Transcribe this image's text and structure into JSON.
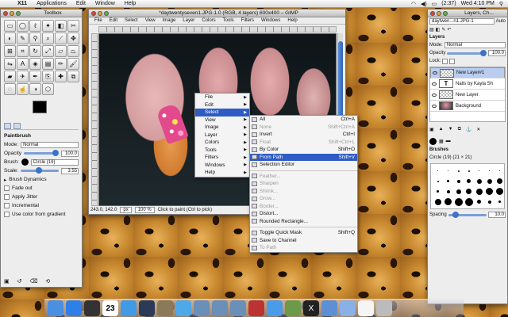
{
  "menubar": {
    "app": "X11",
    "items": [
      "Applications",
      "Edit",
      "Window",
      "Help"
    ],
    "clock": "Wed 4:10 PM",
    "battery": "(2:37)"
  },
  "toolbox": {
    "title": "Toolbox",
    "tool_icons": [
      "rect-select-icon",
      "ellipse-select-icon",
      "free-select-icon",
      "fuzzy-select-icon",
      "color-select-icon",
      "scissors-icon",
      "foreground-select-icon",
      "paths-icon",
      "color-picker-icon",
      "zoom-icon",
      "measure-icon",
      "move-icon",
      "align-icon",
      "crop-icon",
      "rotate-icon",
      "scale-icon",
      "shear-icon",
      "perspective-icon",
      "flip-icon",
      "text-icon",
      "bucket-fill-icon",
      "blend-icon",
      "pencil-icon",
      "paintbrush-icon",
      "eraser-icon",
      "airbrush-icon",
      "ink-icon",
      "clone-icon",
      "heal-icon",
      "perspective-clone-icon",
      "blur-icon",
      "smudge-icon",
      "dodge-burn-icon",
      "cage-icon"
    ],
    "options": {
      "title": "Paintbrush",
      "mode_label": "Mode:",
      "mode_value": "Normal",
      "opacity_label": "Opacity",
      "opacity_value": "100.0",
      "brush_label": "Brush:",
      "brush_value": "Circle (19)",
      "scale_label": "Scale:",
      "scale_value": "3.55",
      "dynamics": "Brush Dynamics",
      "fade_out": "Fade out",
      "apply_jitter": "Apply Jitter",
      "incremental": "Incremental",
      "use_color": "Use color from gradient"
    }
  },
  "image_window": {
    "title": "*daytwentyseven1.JPG-1.0 (RGB, 4 layers) 600x400 – GIMP",
    "menu": [
      "File",
      "Edit",
      "Select",
      "View",
      "Image",
      "Layer",
      "Colors",
      "Tools",
      "Filters",
      "Windows",
      "Help"
    ],
    "coords": "243.0, 142.0",
    "unit": "px",
    "zoom": "100 %",
    "status_msg": "Click to paint (Ctrl to pick)"
  },
  "context_menu": {
    "items": [
      "File",
      "Edit",
      "Select",
      "View",
      "Image",
      "Layer",
      "Colors",
      "Tools",
      "Filters",
      "Windows",
      "Help"
    ],
    "highlighted": "Select"
  },
  "select_menu": {
    "items": [
      {
        "label": "All",
        "key": "Ctrl+A",
        "disabled": false
      },
      {
        "label": "None",
        "key": "Shift+Ctrl+A",
        "disabled": true
      },
      {
        "label": "Invert",
        "key": "Ctrl+I",
        "disabled": false
      },
      {
        "label": "Float",
        "key": "Shift+Ctrl+L",
        "disabled": true
      },
      {
        "label": "By Color",
        "key": "Shift+O",
        "disabled": false
      },
      {
        "label": "From Path",
        "key": "Shift+V",
        "disabled": false
      },
      {
        "label": "Selection Editor",
        "key": "",
        "disabled": false
      },
      {
        "label": "Feather...",
        "key": "",
        "disabled": true
      },
      {
        "label": "Sharpen",
        "key": "",
        "disabled": true
      },
      {
        "label": "Shrink...",
        "key": "",
        "disabled": true
      },
      {
        "label": "Grow...",
        "key": "",
        "disabled": true
      },
      {
        "label": "Border...",
        "key": "",
        "disabled": true
      },
      {
        "label": "Distort...",
        "key": "",
        "disabled": false
      },
      {
        "label": "Rounded Rectangle...",
        "key": "",
        "disabled": false
      },
      {
        "label": "Toggle Quick Mask",
        "key": "Shift+Q",
        "disabled": false
      },
      {
        "label": "Save to Channel",
        "key": "",
        "disabled": false
      },
      {
        "label": "To Path",
        "key": "",
        "disabled": true
      }
    ],
    "highlighted": "From Path"
  },
  "layers": {
    "title": "Layers, Ch...",
    "image_select": "daytwen...n1.JPG-1",
    "auto_label": "Auto",
    "section": "Layers",
    "mode_label": "Mode:",
    "mode_value": "Normal",
    "opacity_label": "Opacity",
    "opacity_value": "100.0",
    "lock_label": "Lock:",
    "list": [
      {
        "name": "New Layer#1",
        "thumb": "transparent",
        "selected": true
      },
      {
        "name": "Nails by Kayla Sh",
        "thumb": "text",
        "selected": false
      },
      {
        "name": "New Layer",
        "thumb": "transparent",
        "selected": false
      },
      {
        "name": "Background",
        "thumb": "image",
        "selected": false
      }
    ],
    "brushes_title": "Brushes",
    "brush_info": "Circle (19) (21 × 21)",
    "spacing_label": "Spacing",
    "spacing_value": "10.0"
  },
  "dock": {
    "items": [
      "finder-icon",
      "appstore-icon",
      "dashboard-icon",
      "calendar-icon",
      "safari-icon",
      "timemachine-icon",
      "gimp-icon",
      "itunes-icon",
      "app-icon",
      "app-icon",
      "app-icon",
      "photobooth-icon",
      "cloud-icon",
      "iphoto-icon",
      "x11-icon",
      "folder-icon",
      "download-icon",
      "document-icon",
      "trash-icon"
    ],
    "calendar_day": "23"
  }
}
